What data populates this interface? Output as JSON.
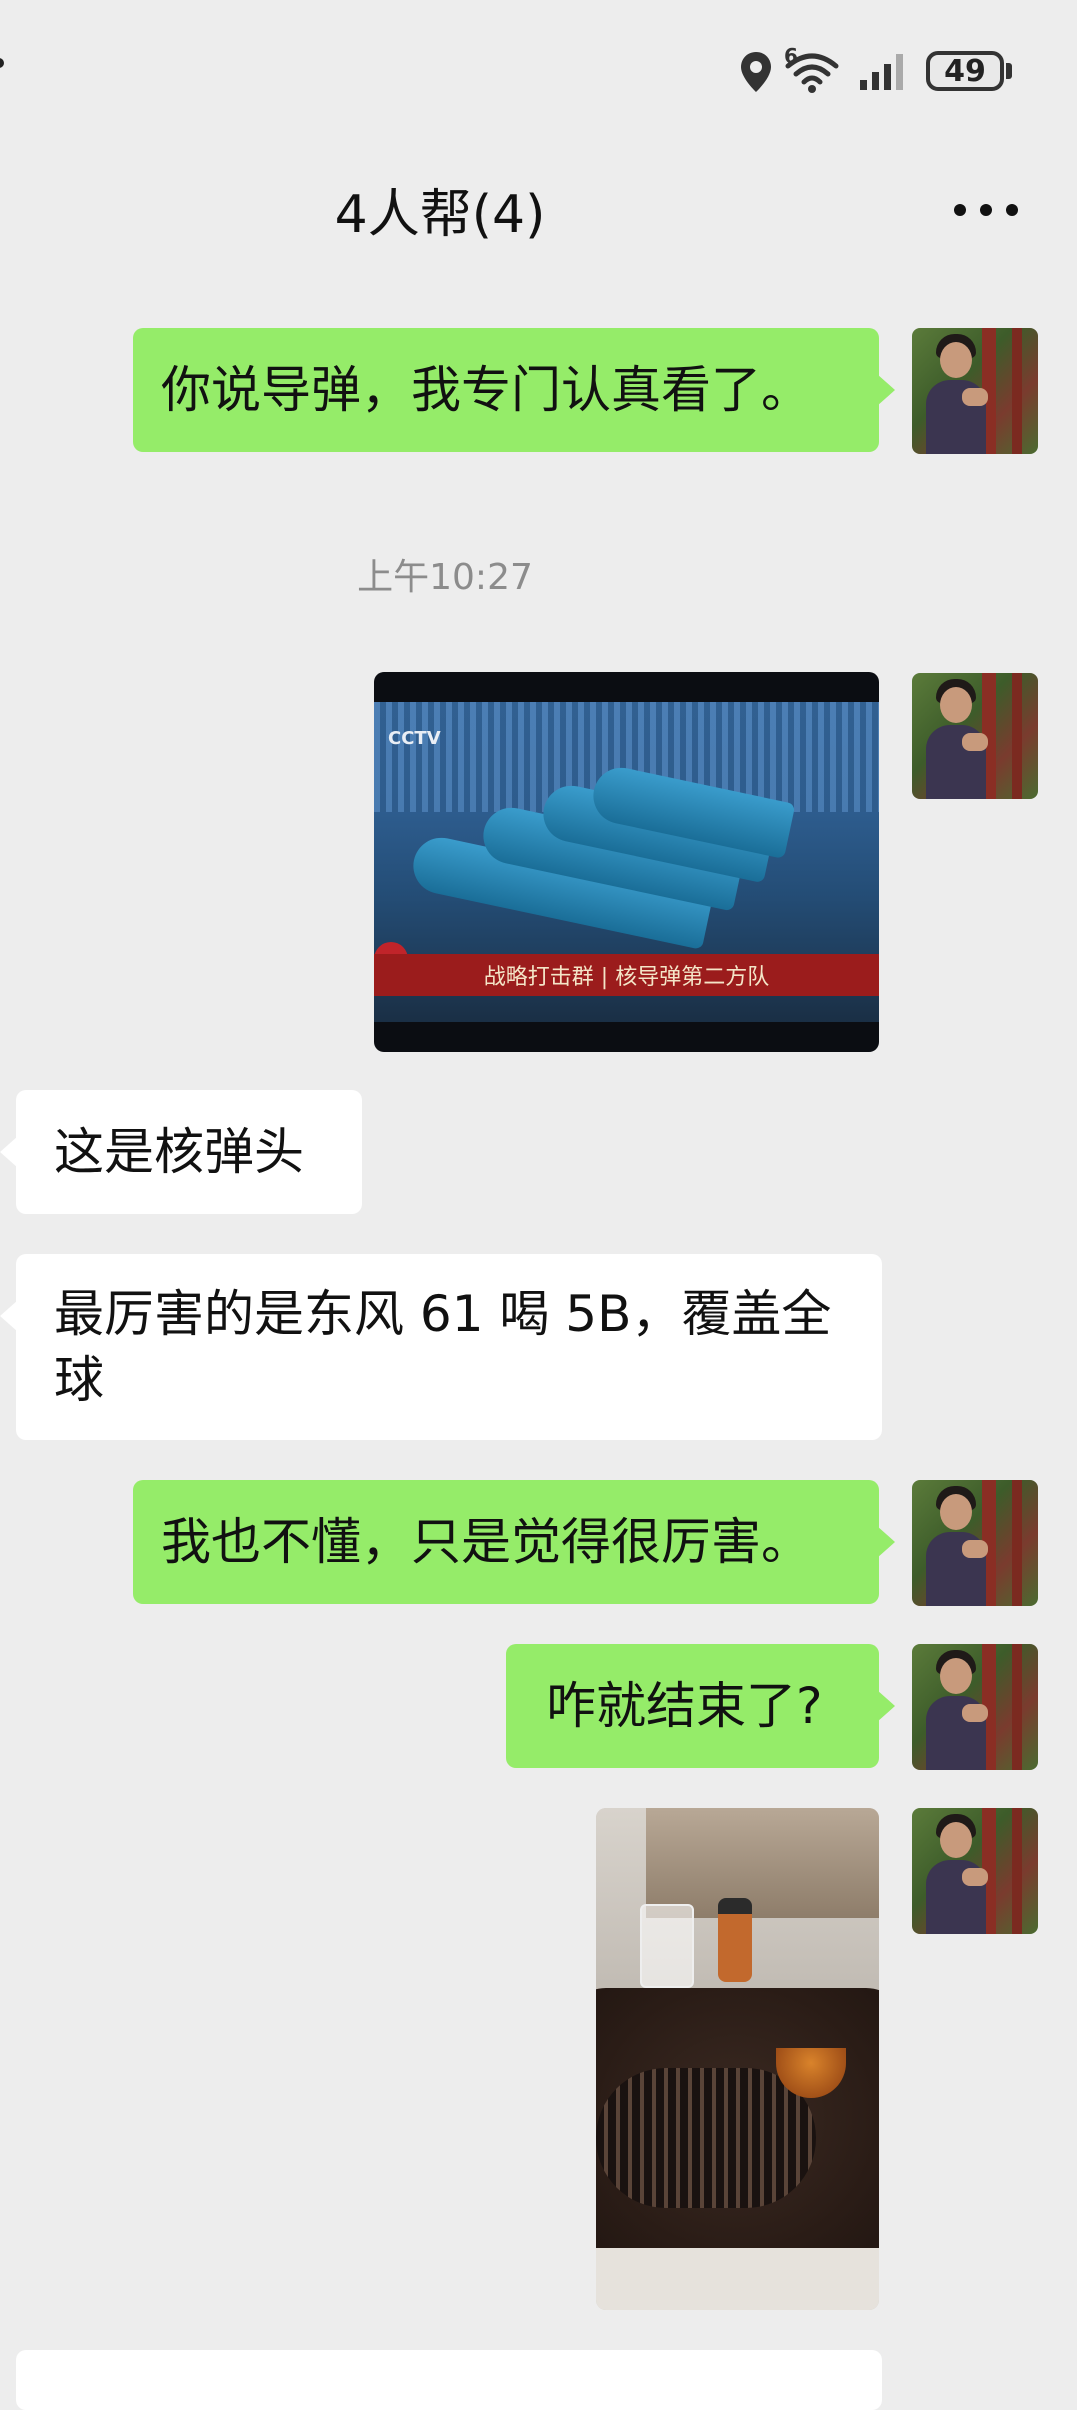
{
  "status_bar": {
    "battery": "49",
    "signal_superscript": "6"
  },
  "header": {
    "title": "4人帮(4)"
  },
  "messages": [
    {
      "side": "right",
      "text": "你说导弹，我专门认真看了。"
    },
    {
      "type": "timestamp",
      "text": "上午10:27"
    },
    {
      "side": "right",
      "type": "image",
      "caption": "战略打击群 | 核导弹第二方队",
      "tv_logo": "CCTV"
    },
    {
      "side": "left",
      "text": "这是核弹头"
    },
    {
      "side": "left",
      "text": "最厉害的是东风 61 喝 5B，覆盖全球"
    },
    {
      "side": "right",
      "text": "我也不懂，只是觉得很厉害。"
    },
    {
      "side": "right",
      "text": "咋就结束了?"
    },
    {
      "side": "right",
      "type": "image"
    }
  ],
  "icons": {
    "location": "location-pin-icon",
    "wifi": "wifi-icon",
    "signal": "cellular-signal-icon",
    "battery": "battery-icon",
    "more": "more-dots-icon"
  },
  "colors": {
    "background": "#ededed",
    "outgoing_bubble": "#95ec69",
    "incoming_bubble": "#ffffff"
  }
}
